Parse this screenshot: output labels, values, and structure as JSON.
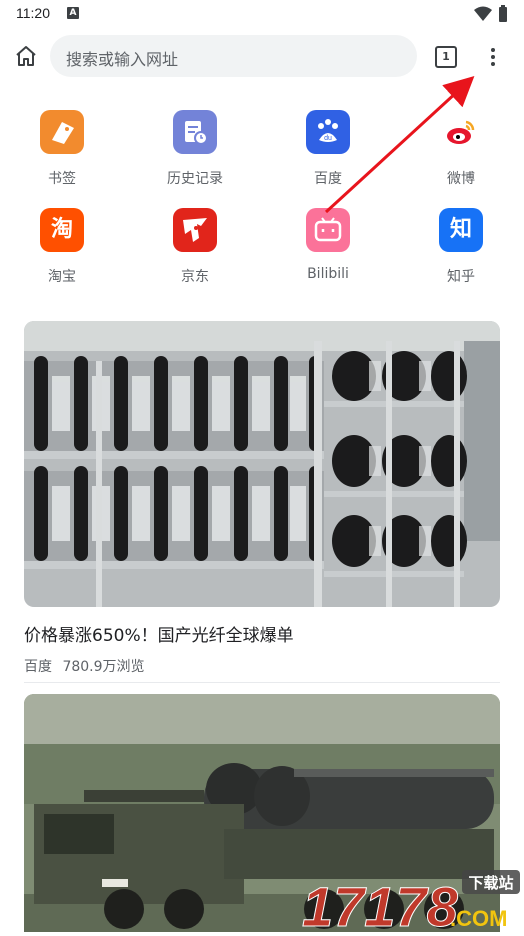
{
  "status_bar": {
    "time": "11:20",
    "indicator": "A"
  },
  "toolbar": {
    "search_placeholder": "搜索或输入网址",
    "tab_count": "1"
  },
  "shortcuts": [
    {
      "label": "书签",
      "color": "#f28b2e",
      "icon": "bookmark-icon"
    },
    {
      "label": "历史记录",
      "color": "#7383d8",
      "icon": "history-icon"
    },
    {
      "label": "百度",
      "color": "#3061e4",
      "icon": "baidu-icon"
    },
    {
      "label": "微博",
      "color": "#ffffff",
      "icon": "weibo-icon"
    },
    {
      "label": "淘宝",
      "color": "#ff5000",
      "icon": "taobao-icon",
      "glyph": "淘"
    },
    {
      "label": "京东",
      "color": "#e1251b",
      "icon": "jd-icon"
    },
    {
      "label": "Bilibili",
      "color": "#fb7299",
      "icon": "bilibili-icon"
    },
    {
      "label": "知乎",
      "color": "#1772f6",
      "icon": "zhihu-icon",
      "glyph": "知"
    }
  ],
  "feed": [
    {
      "title": "价格暴涨650%！国产光纤全球爆单",
      "source": "百度",
      "views": "780.9万浏览"
    }
  ],
  "watermark": {
    "number": "17178",
    "suffix": ".COM",
    "site": "下载站"
  }
}
